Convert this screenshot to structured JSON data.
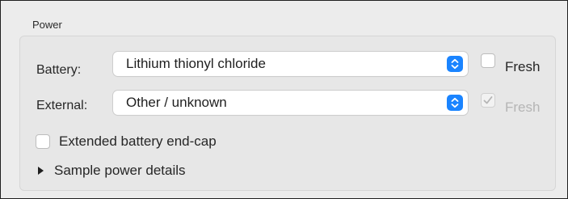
{
  "group": {
    "title": "Power"
  },
  "battery": {
    "label": "Battery:",
    "value": "Lithium thionyl chloride",
    "fresh_label": "Fresh",
    "fresh_checked": false
  },
  "external": {
    "label": "External:",
    "value": "Other / unknown",
    "fresh_label": "Fresh",
    "fresh_checked": true,
    "fresh_enabled": false
  },
  "endcap": {
    "label": "Extended battery end-cap",
    "checked": false
  },
  "details": {
    "label": "Sample power details",
    "expanded": false
  },
  "colors": {
    "accent": "#1a84ff",
    "disabled_text": "#b5b5b5",
    "background": "#ececec"
  },
  "icons": {
    "stepper": "up-down-chevron",
    "disclosure": "triangle-right",
    "check": "checkmark"
  }
}
